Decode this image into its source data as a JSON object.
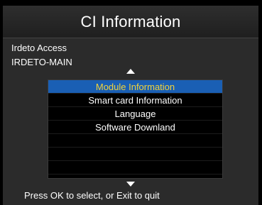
{
  "header": {
    "title": "CI Information"
  },
  "info": {
    "line1": "Irdeto Access",
    "line2": "IRDETO-MAIN"
  },
  "menu": {
    "items": [
      {
        "label": "Module Information",
        "selected": true
      },
      {
        "label": "Smart card Information",
        "selected": false
      },
      {
        "label": "Language",
        "selected": false
      },
      {
        "label": "Software Downland",
        "selected": false
      },
      {
        "label": "",
        "selected": false
      },
      {
        "label": "",
        "selected": false
      },
      {
        "label": "",
        "selected": false
      }
    ]
  },
  "footer": {
    "hint": "Press OK to select, or Exit to quit"
  },
  "colors": {
    "highlight": "#1a5fb4",
    "highlight_text": "#f2d23a"
  },
  "icons": {
    "scroll_up": "triangle-up-icon",
    "scroll_down": "triangle-down-icon"
  }
}
